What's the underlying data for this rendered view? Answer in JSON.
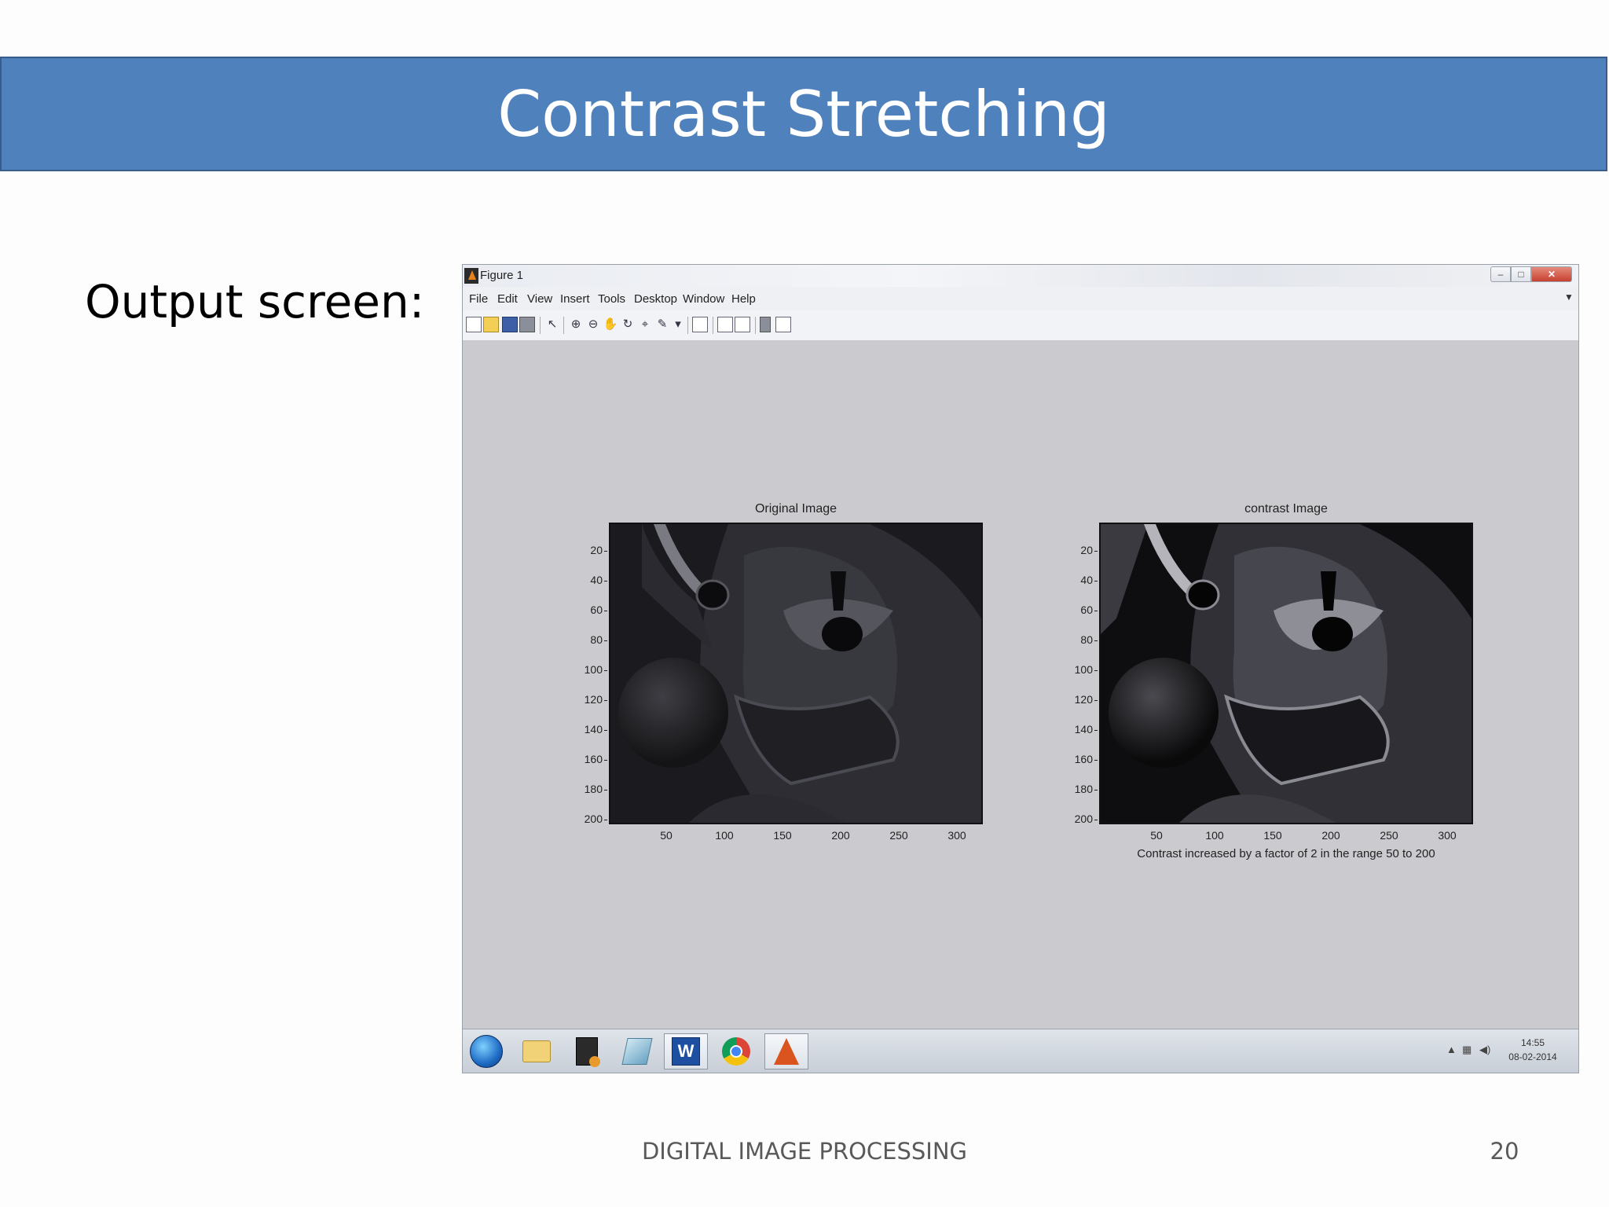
{
  "slide": {
    "title": "Contrast Stretching",
    "side_label": "Output screen:",
    "footer": "DIGITAL IMAGE PROCESSING",
    "page_number": "20"
  },
  "window": {
    "title": "Figure 1",
    "menu": [
      "File",
      "Edit",
      "View",
      "Insert",
      "Tools",
      "Desktop",
      "Window",
      "Help"
    ],
    "controls": {
      "minimize": "–",
      "maximize": "□",
      "close": "✕"
    }
  },
  "figure": {
    "plots": [
      {
        "title": "Original Image",
        "y_ticks": [
          "20",
          "40",
          "60",
          "80",
          "100",
          "120",
          "140",
          "160",
          "180",
          "200"
        ],
        "x_ticks": [
          "50",
          "100",
          "150",
          "200",
          "250",
          "300"
        ],
        "x_caption": ""
      },
      {
        "title": "contrast Image",
        "y_ticks": [
          "20",
          "40",
          "60",
          "80",
          "100",
          "120",
          "140",
          "160",
          "180",
          "200"
        ],
        "x_ticks": [
          "50",
          "100",
          "150",
          "200",
          "250",
          "300"
        ],
        "x_caption": "Contrast increased by a factor of 2 in the range 50 to 200"
      }
    ]
  },
  "taskbar": {
    "apps": [
      "start-orb",
      "folder-icon",
      "app-icon",
      "page-icon",
      "word-icon",
      "chrome-icon",
      "matlab-icon"
    ],
    "clock_time": "14:55",
    "clock_date": "08-02-2014"
  },
  "colors": {
    "banner": "#4f81bd",
    "figure_bg": "#cbcbcf"
  }
}
